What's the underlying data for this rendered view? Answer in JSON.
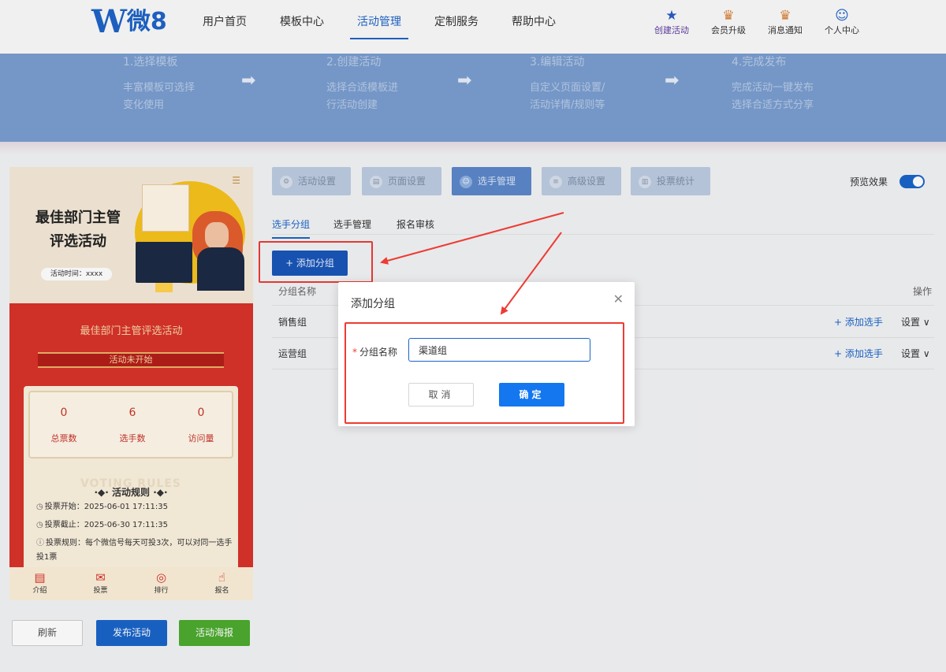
{
  "header": {
    "logo_w": "W",
    "logo_text": "微8",
    "nav": [
      {
        "label": "用户首页",
        "active": false
      },
      {
        "label": "模板中心",
        "active": false
      },
      {
        "label": "活动管理",
        "active": true
      },
      {
        "label": "定制服务",
        "active": false
      },
      {
        "label": "帮助中心",
        "active": false
      }
    ],
    "tools": [
      {
        "label": "创建活动",
        "icon": "star-icon",
        "glyph": "★"
      },
      {
        "label": "会员升级",
        "icon": "crown-badge-icon",
        "glyph": "♛"
      },
      {
        "label": "消息通知",
        "icon": "bell-badge-icon",
        "glyph": "♛"
      },
      {
        "label": "个人中心",
        "icon": "user-circle-icon",
        "glyph": "☺"
      }
    ]
  },
  "steps": [
    {
      "title": "1.选择模板",
      "desc1": "丰富模板可选择",
      "desc2": "变化使用"
    },
    {
      "title": "2.创建活动",
      "desc1": "选择合适模板进",
      "desc2": "行活动创建"
    },
    {
      "title": "3.编辑活动",
      "desc1": "自定义页面设置/",
      "desc2": "活动详情/规则等"
    },
    {
      "title": "4.完成发布",
      "desc1": "完成活动一键发布",
      "desc2": "选择合适方式分享"
    }
  ],
  "preview": {
    "title_line1": "最佳部门主管",
    "title_line2": "评选活动",
    "time": "活动时间：xxxx",
    "red_title": "最佳部门主管评选活动",
    "status": "活动未开始",
    "stats": [
      {
        "value": "0",
        "label": "总票数"
      },
      {
        "value": "6",
        "label": "选手数"
      },
      {
        "value": "0",
        "label": "访问量"
      }
    ],
    "rules_ghost": "VOTING RULES",
    "rules_head": "活动规则",
    "rules": [
      {
        "label": "投票开始：",
        "value": "2025-06-01 17:11:35"
      },
      {
        "label": "投票截止：",
        "value": "2025-06-30 17:11:35"
      },
      {
        "label": "投票规则：",
        "value": "每个微信号每天可投3次，可以对同一选手投1票"
      }
    ],
    "tabbar": [
      {
        "label": "介绍",
        "icon": "document-icon",
        "glyph": "▤"
      },
      {
        "label": "投票",
        "icon": "envelope-icon",
        "glyph": "✉"
      },
      {
        "label": "排行",
        "icon": "medal-icon",
        "glyph": "◎"
      },
      {
        "label": "报名",
        "icon": "hand-pointer-icon",
        "glyph": "☝"
      }
    ]
  },
  "left_buttons": {
    "refresh": "刷新",
    "publish": "发布活动",
    "poster": "活动海报"
  },
  "panel_tabs": [
    {
      "label": "活动设置",
      "active": false
    },
    {
      "label": "页面设置",
      "active": false
    },
    {
      "label": "选手管理",
      "active": true
    },
    {
      "label": "高级设置",
      "active": false
    },
    {
      "label": "投票统计",
      "active": false
    }
  ],
  "preview_toggle": {
    "label": "预览效果",
    "on": true
  },
  "sub_tabs": [
    {
      "label": "选手分组",
      "active": true
    },
    {
      "label": "选手管理",
      "active": false
    },
    {
      "label": "报名审核",
      "active": false
    }
  ],
  "add_group_button": "+ 添加分组",
  "table": {
    "headers": {
      "name": "分组名称",
      "ops": "操作"
    },
    "rows": [
      {
        "name": "销售组",
        "add": "+ 添加选手",
        "settings": "设置 ∨"
      },
      {
        "name": "运营组",
        "add": "+ 添加选手",
        "settings": "设置 ∨"
      }
    ]
  },
  "dialog": {
    "title": "添加分组",
    "close": "✕",
    "field_required": "*",
    "field_label": "分组名称",
    "field_value": "渠道组",
    "cancel": "取消",
    "ok": "确定"
  },
  "colors": {
    "accent": "#1a64c8",
    "highlight": "#ee3b32",
    "banner": "#7a9ed0"
  }
}
